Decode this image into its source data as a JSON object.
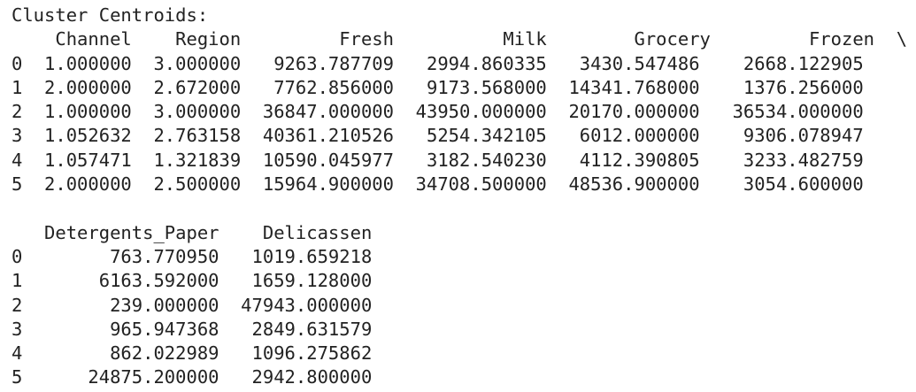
{
  "output": {
    "heading": "Cluster Centroids:",
    "block1": {
      "header_line": "    Channel    Region         Fresh          Milk        Grocery         Frozen  \\",
      "rows": [
        "0  1.000000  3.000000   9263.787709   2994.860335   3430.547486    2668.122905",
        "1  2.000000  2.672000   7762.856000   9173.568000  14341.768000    1376.256000",
        "2  1.000000  3.000000  36847.000000  43950.000000  20170.000000   36534.000000",
        "3  1.052632  2.763158  40361.210526   5254.342105   6012.000000    9306.078947",
        "4  1.057471  1.321839  10590.045977   3182.540230   4112.390805    3233.482759",
        "5  2.000000  2.500000  15964.900000  34708.500000  48536.900000    3054.600000"
      ]
    },
    "block2": {
      "header_line": "   Detergents_Paper    Delicassen",
      "rows": [
        "0        763.770950   1019.659218",
        "1       6163.592000   1659.128000",
        "2        239.000000  47943.000000",
        "3        965.947368   2849.631579",
        "4        862.022989   1096.275862",
        "5      24875.200000   2942.800000"
      ]
    }
  }
}
